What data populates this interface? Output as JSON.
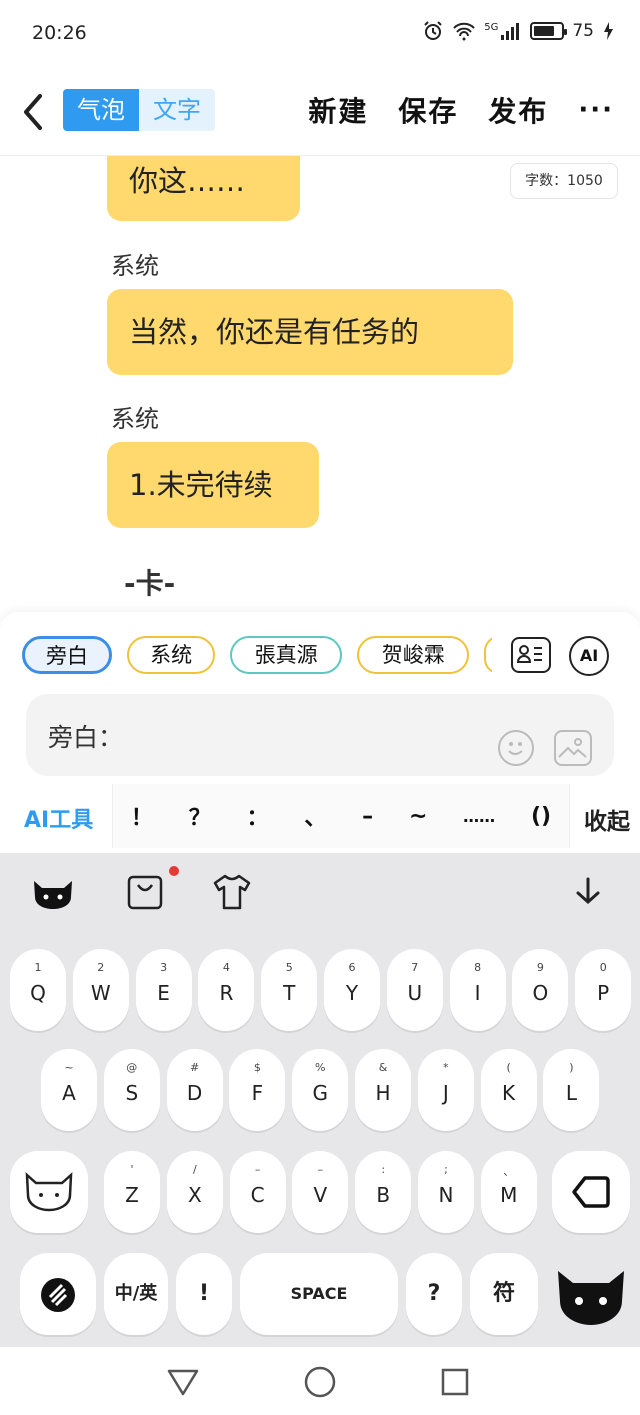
{
  "status": {
    "time": "20:26",
    "network": "5G",
    "battery": "75",
    "battery_level": 0.75
  },
  "header": {
    "segment": [
      "气泡",
      "文字"
    ],
    "actions": [
      "新建",
      "保存",
      "发布"
    ],
    "more": "···"
  },
  "chat": {
    "word_count": "字数：1050",
    "messages": [
      {
        "speaker": "",
        "text": "你这……"
      },
      {
        "speaker": "系统",
        "text": "当然，你还是有任务的"
      },
      {
        "speaker": "系统",
        "text": "1.未完待续"
      }
    ],
    "scene_marker": "-卡-"
  },
  "composer": {
    "characters": [
      "旁白",
      "系统",
      "張真源",
      "贺峻霖"
    ],
    "ai_button": "AI",
    "input_label": "旁白：",
    "ai_tools": "AI工具",
    "punctuation": [
      "！",
      "？",
      "：",
      "、",
      "–",
      "~",
      "……",
      "()"
    ],
    "collapse": "收起"
  },
  "keyboard": {
    "row1": [
      {
        "sub": "1",
        "main": "Q"
      },
      {
        "sub": "2",
        "main": "W"
      },
      {
        "sub": "3",
        "main": "E"
      },
      {
        "sub": "4",
        "main": "R"
      },
      {
        "sub": "5",
        "main": "T"
      },
      {
        "sub": "6",
        "main": "Y"
      },
      {
        "sub": "7",
        "main": "U"
      },
      {
        "sub": "8",
        "main": "I"
      },
      {
        "sub": "9",
        "main": "O"
      },
      {
        "sub": "0",
        "main": "P"
      }
    ],
    "row2": [
      {
        "sub": "~",
        "main": "A"
      },
      {
        "sub": "@",
        "main": "S"
      },
      {
        "sub": "#",
        "main": "D"
      },
      {
        "sub": "$",
        "main": "F"
      },
      {
        "sub": "%",
        "main": "G"
      },
      {
        "sub": "&",
        "main": "H"
      },
      {
        "sub": "*",
        "main": "J"
      },
      {
        "sub": "(",
        "main": "K"
      },
      {
        "sub": ")",
        "main": "L"
      }
    ],
    "row3": [
      {
        "sub": "'",
        "main": "Z"
      },
      {
        "sub": "/",
        "main": "X"
      },
      {
        "sub": "–",
        "main": "C"
      },
      {
        "sub": "–",
        "main": "V"
      },
      {
        "sub": ":",
        "main": "B"
      },
      {
        "sub": ";",
        "main": "N"
      },
      {
        "sub": "、",
        "main": "M"
      }
    ],
    "lang": "中/英",
    "excl": "!",
    "space": "SPACE",
    "question": "?",
    "symbol": "符"
  }
}
